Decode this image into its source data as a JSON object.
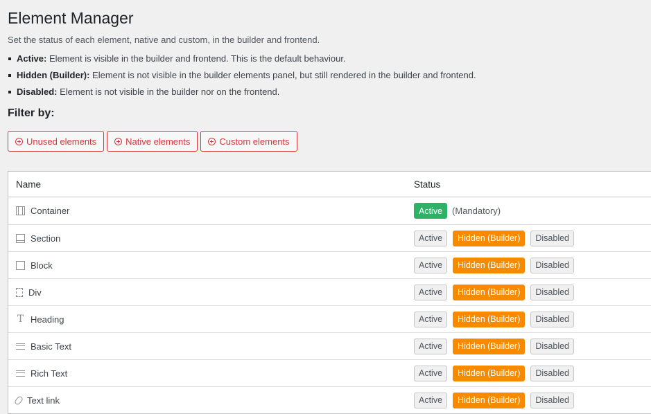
{
  "page": {
    "title": "Element Manager",
    "description": "Set the status of each element, native and custom, in the builder and frontend."
  },
  "legend": [
    {
      "term": "Active:",
      "text": " Element is visible in the builder and frontend. This is the default behaviour."
    },
    {
      "term": "Hidden (Builder):",
      "text": " Element is not visible in the builder elements panel, but still rendered in the builder and frontend."
    },
    {
      "term": "Disabled:",
      "text": " Element is not visible in the builder nor on the frontend."
    }
  ],
  "filter": {
    "heading": "Filter by:",
    "buttons": [
      "Unused elements",
      "Native elements",
      "Custom elements"
    ]
  },
  "table": {
    "headers": {
      "name": "Name",
      "status": "Status"
    },
    "labels": {
      "active": "Active",
      "hidden": "Hidden (Builder)",
      "disabled": "Disabled",
      "mandatory": "(Mandatory)"
    },
    "rows": [
      {
        "name": "Container",
        "icon": "container-icon",
        "status": "active",
        "mandatory": true
      },
      {
        "name": "Section",
        "icon": "section-icon",
        "status": "hidden"
      },
      {
        "name": "Block",
        "icon": "block-icon",
        "status": "hidden"
      },
      {
        "name": "Div",
        "icon": "div-icon",
        "status": "hidden"
      },
      {
        "name": "Heading",
        "icon": "heading-icon",
        "status": "hidden"
      },
      {
        "name": "Basic Text",
        "icon": "text-lines-icon",
        "status": "hidden"
      },
      {
        "name": "Rich Text",
        "icon": "text-lines-icon",
        "status": "hidden"
      },
      {
        "name": "Text link",
        "icon": "link-icon",
        "status": "hidden"
      }
    ]
  },
  "colors": {
    "active": "#2fb267",
    "hidden": "#f88a00",
    "filter_accent": "#d63638"
  }
}
